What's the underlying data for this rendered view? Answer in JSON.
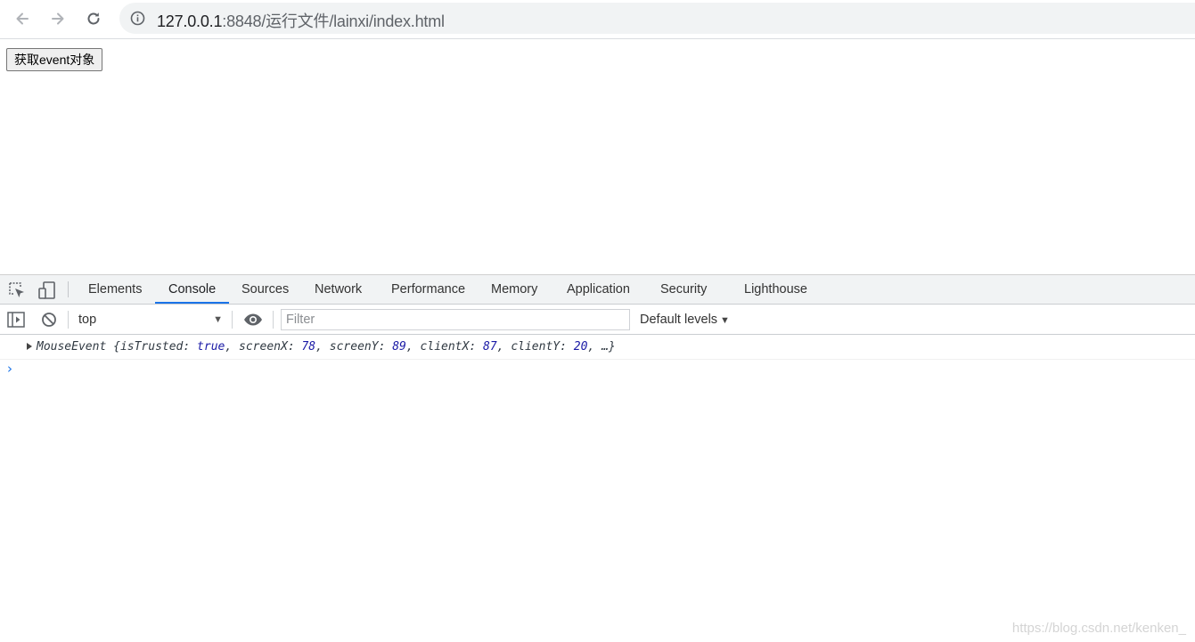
{
  "browser": {
    "url_host": "127.0.0.1",
    "url_rest": ":8848/运行文件/lainxi/index.html"
  },
  "page": {
    "button_label": "获取event对象"
  },
  "devtools": {
    "tabs": [
      {
        "label": "Elements"
      },
      {
        "label": "Console",
        "active": true
      },
      {
        "label": "Sources"
      },
      {
        "label": "Network"
      },
      {
        "label": "Performance"
      },
      {
        "label": "Memory"
      },
      {
        "label": "Application"
      },
      {
        "label": "Security"
      },
      {
        "label": "Lighthouse"
      }
    ],
    "console": {
      "context": "top",
      "filter_placeholder": "Filter",
      "levels_label": "Default levels",
      "log": {
        "type_name": "MouseEvent",
        "isTrusted_key": "isTrusted",
        "isTrusted_value": "true",
        "screenX_key": "screenX",
        "screenX_value": "78",
        "screenY_key": "screenY",
        "screenY_value": "89",
        "clientX_key": "clientX",
        "clientX_value": "87",
        "clientY_key": "clientY",
        "clientY_value": "20",
        "ellipsis": "…"
      }
    },
    "accent_color": "#1a73e8"
  },
  "watermark": "https://blog.csdn.net/kenken_"
}
